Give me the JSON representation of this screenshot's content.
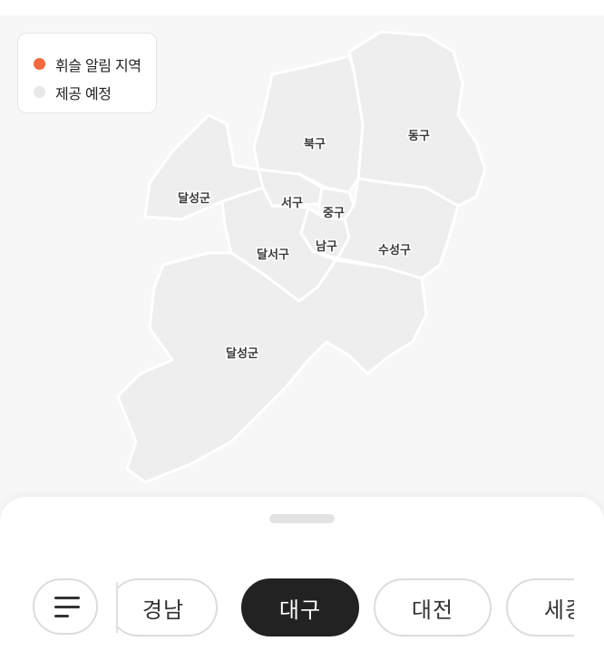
{
  "legend": {
    "items": [
      {
        "label": "휘슬 알림 지역",
        "color": "#f26a3d"
      },
      {
        "label": "제공 예정",
        "color": "#e8e8e8"
      }
    ]
  },
  "map": {
    "districts": [
      "북구",
      "동구",
      "달성군",
      "서구",
      "중구",
      "남구",
      "달서구",
      "수성구",
      "달성군"
    ],
    "fill_color": "#eeeeee"
  },
  "bottom_sheet": {
    "menu_icon": "menu-icon",
    "regions": [
      {
        "label": "경남",
        "active": false
      },
      {
        "label": "대구",
        "active": true
      },
      {
        "label": "대전",
        "active": false
      },
      {
        "label": "세종",
        "active": false
      }
    ]
  }
}
